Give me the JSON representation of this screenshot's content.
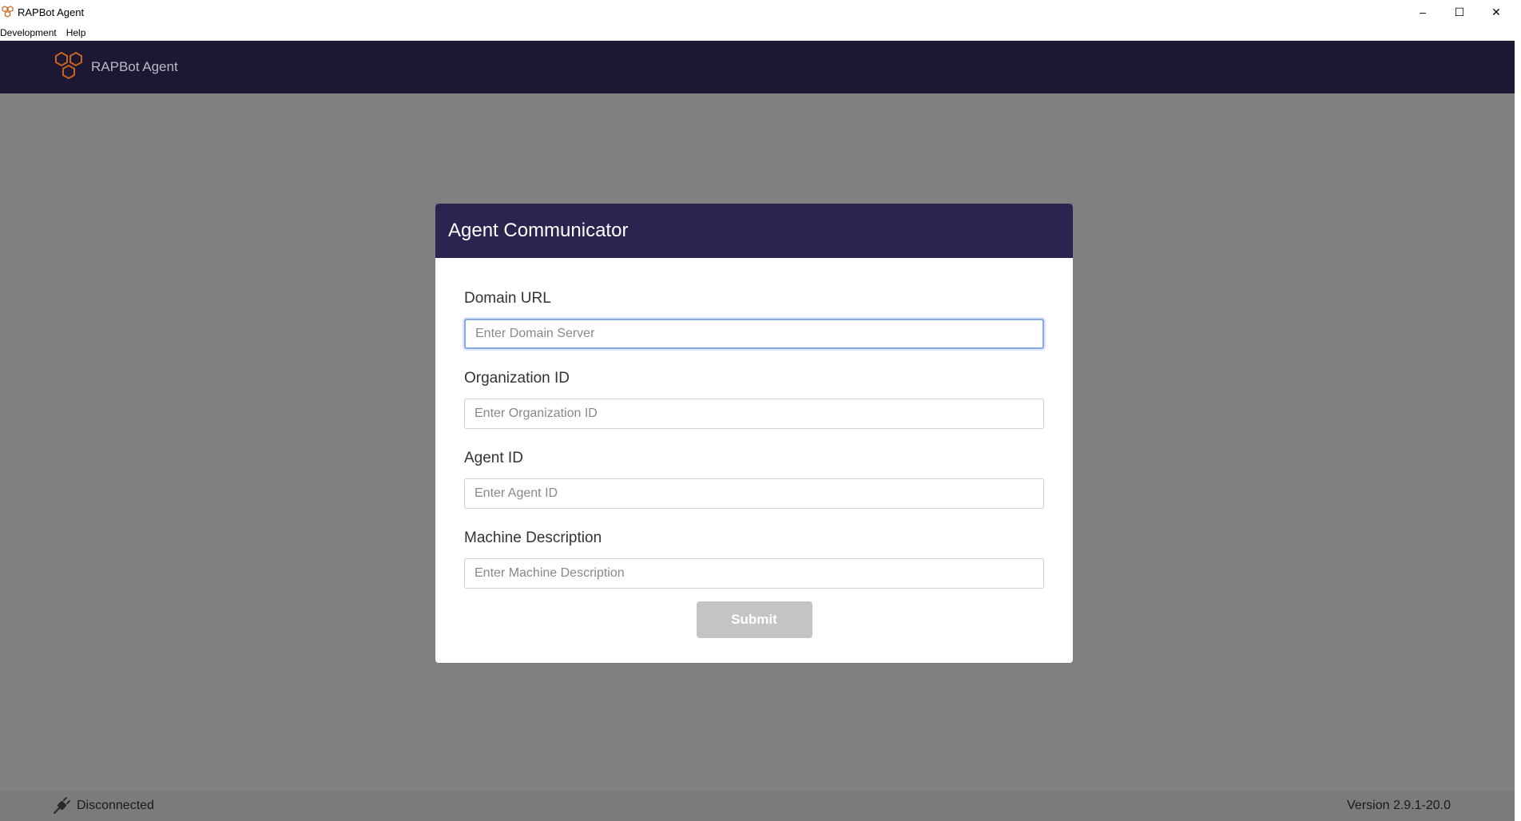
{
  "window": {
    "title": "RAPBot Agent",
    "controls": {
      "minimize": "–",
      "maximize": "☐",
      "close": "✕"
    }
  },
  "menu": {
    "items": [
      {
        "label": "Development"
      },
      {
        "label": "Help"
      }
    ]
  },
  "header": {
    "brand": "RAPBot Agent",
    "logo_icon": "hexagon-cluster-icon"
  },
  "dialog": {
    "title": "Agent Communicator",
    "fields": [
      {
        "label": "Domain URL",
        "placeholder": "Enter Domain Server",
        "value": ""
      },
      {
        "label": "Organization ID",
        "placeholder": "Enter Organization ID",
        "value": ""
      },
      {
        "label": "Agent ID",
        "placeholder": "Enter Agent ID",
        "value": ""
      },
      {
        "label": "Machine Description",
        "placeholder": "Enter Machine Description",
        "value": ""
      }
    ],
    "submit_label": "Submit"
  },
  "status": {
    "connection_text": "Disconnected",
    "connection_icon": "plug-icon",
    "version": "Version 2.9.1-20.0"
  },
  "colors": {
    "header_bg": "#1c1833",
    "dialog_header_bg": "#2b2350",
    "logo_accent": "#c8641e",
    "backdrop": "#808080",
    "submit_disabled": "#c4c4c4"
  }
}
